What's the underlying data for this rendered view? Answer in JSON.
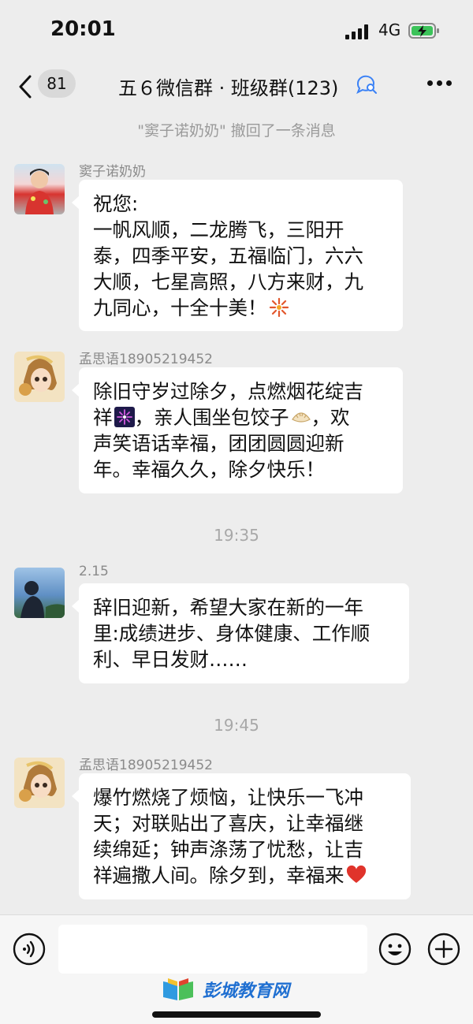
{
  "status": {
    "time": "20:01",
    "network": "4G"
  },
  "nav": {
    "badge": "81",
    "title": "五６微信群 · 班级群(123)"
  },
  "system_message": "\"窦子诺奶奶\" 撤回了一条消息",
  "messages": [
    {
      "sender": "窦子诺奶奶",
      "lines": [
        "祝您:",
        "一帆风顺，二龙腾飞，三阳开",
        "泰，四季平安，五福临门，六六",
        "大顺，七星高照，八方来财，九",
        "九同心，十全十美！"
      ],
      "emoji": "firecracker-emoji"
    },
    {
      "sender": "孟思语18905219452",
      "lines": [
        "除旧守岁过除夕，点燃烟花绽吉",
        "祥",
        "，亲人围坐包饺子",
        "，欢",
        "声笑语话幸福，团团圆圆迎新",
        "年。幸福久久，除夕快乐！"
      ]
    },
    {
      "sender": "2.15",
      "lines": [
        "辞旧迎新，希望大家在新的一年",
        "里:成绩进步、身体健康、工作顺",
        "利、早日发财……"
      ]
    },
    {
      "sender": "孟思语18905219452",
      "lines": [
        "爆竹燃烧了烦恼，让快乐一飞冲",
        "天；对联贴出了喜庆，让幸福继",
        "续绵延；钟声涤荡了忧愁，让吉",
        "祥遍撒人间。除夕到，幸福来"
      ],
      "emoji": "red-heart-emoji"
    }
  ],
  "timestamps": [
    "19:35",
    "19:45"
  ],
  "watermark": "彭城教育网",
  "colors": {
    "background": "#ededed",
    "bubble": "#ffffff",
    "watermark": "#1f6fd1"
  }
}
